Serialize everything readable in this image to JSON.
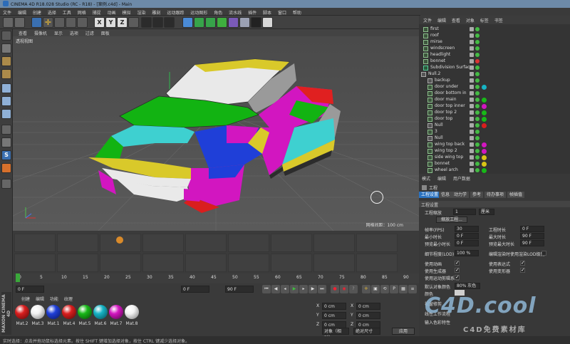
{
  "app": {
    "title": "CINEMA 4D R18.028 Studio (RC - R18) - [案例.c4d] - Main",
    "menu": [
      "文件",
      "编辑",
      "创建",
      "选择",
      "工具",
      "网格",
      "捕捉",
      "动画",
      "模拟",
      "渲染",
      "雕刻",
      "运动跟踪",
      "运动图形",
      "角色",
      "流水线",
      "插件",
      "脚本",
      "窗口",
      "帮助"
    ]
  },
  "toolbar_icons": {
    "axes": [
      "X",
      "Y",
      "Z"
    ]
  },
  "viewport": {
    "menu": [
      "查看",
      "摄像机",
      "显示",
      "选项",
      "过滤",
      "面板"
    ],
    "camera_label": "透视视图",
    "scale_label": "网格间距：100 cm"
  },
  "timeline": {
    "ticks": [
      "0",
      "5",
      "10",
      "15",
      "20",
      "25",
      "30",
      "35",
      "40",
      "45",
      "50",
      "55",
      "60",
      "65",
      "70",
      "75",
      "80",
      "85",
      "90"
    ],
    "end_frame": "90 F",
    "current_frame": "0 F",
    "field_start": "0 F",
    "field_end": "90 F",
    "min_field": "0 F"
  },
  "materials": {
    "tabs": [
      "创建",
      "编辑",
      "功能",
      "纹理"
    ],
    "items": [
      {
        "name": "Mat.2",
        "color": "#d91e1e"
      },
      {
        "name": "Mat.3",
        "color": "#f2f2f2"
      },
      {
        "name": "Mat.1",
        "color": "#1f3fd8"
      },
      {
        "name": "Mat.4",
        "color": "#d91e1e"
      },
      {
        "name": "Mat.5",
        "color": "#18b818"
      },
      {
        "name": "Mat.6",
        "color": "#16b3c4"
      },
      {
        "name": "Mat.7",
        "color": "#d216c0"
      },
      {
        "name": "Mat.8",
        "color": "#f2f2f2"
      }
    ]
  },
  "coords": {
    "labels": [
      "X",
      "Y",
      "Z",
      "X",
      "Y",
      "Z",
      "H",
      "P",
      "B"
    ],
    "value": "0 cm",
    "dropdown": "对象（相对）",
    "dropdown2": "绝对尺寸",
    "apply": "应用"
  },
  "objects": {
    "menu": [
      "文件",
      "编辑",
      "查看",
      "对象",
      "标签",
      "书签"
    ],
    "rows": [
      {
        "name": "first",
        "indent": 0
      },
      {
        "name": "roof",
        "indent": 0
      },
      {
        "name": "mirse",
        "indent": 0
      },
      {
        "name": "windscreen",
        "indent": 0
      },
      {
        "name": "headlight",
        "indent": 0
      },
      {
        "name": "bonnet",
        "indent": 0
      },
      {
        "name": "Subdivision Surface",
        "indent": 0
      },
      {
        "name": "Null.2",
        "indent": 0
      },
      {
        "name": "backup",
        "indent": 1
      },
      {
        "name": "door under",
        "indent": 1
      },
      {
        "name": "door bottom in",
        "indent": 1
      },
      {
        "name": "door main",
        "indent": 1
      },
      {
        "name": "door top inner",
        "indent": 1
      },
      {
        "name": "door top 2",
        "indent": 1
      },
      {
        "name": "door top",
        "indent": 1
      },
      {
        "name": "Null",
        "indent": 1
      },
      {
        "name": "3",
        "indent": 1
      },
      {
        "name": "Null",
        "indent": 1
      },
      {
        "name": "wing top back",
        "indent": 1
      },
      {
        "name": "wing top 2",
        "indent": 1
      },
      {
        "name": "side wing top",
        "indent": 1
      },
      {
        "name": "bonnet",
        "indent": 1
      },
      {
        "name": "wheel arch",
        "indent": 1
      }
    ],
    "mat_colors": [
      "",
      "",
      "",
      "",
      "",
      "",
      "",
      "",
      "",
      "#16b3c4",
      "",
      "#18b818",
      "#d216c0",
      "#18b818",
      "#18b818",
      "#d91e1e",
      "",
      "",
      "#d216c0",
      "#d216c0",
      "#d9c516",
      "#d9c516",
      "#18b818"
    ]
  },
  "attributes": {
    "tabs": [
      "模式",
      "编辑",
      "用户数据"
    ],
    "header": "工程",
    "subtabs": [
      "工程设置",
      "信息",
      "动力学",
      "参考",
      "待办事项",
      "帧插值"
    ],
    "section": "工程设置",
    "scale_label": "工程缩放",
    "scale_value": "1",
    "scale_unit": "厘米",
    "scale_button": "缩放工程...",
    "params_left": [
      {
        "label": "帧率(FPS)",
        "value": "30"
      },
      {
        "label": "最小时长",
        "value": "0 F"
      },
      {
        "label": "预览最小时长",
        "value": "0 F"
      },
      {
        "label": "细节程度(LOD)",
        "value": "100 %"
      }
    ],
    "params_right": [
      {
        "label": "工程时长",
        "value": "0 F"
      },
      {
        "label": "最大时长",
        "value": "90 F"
      },
      {
        "label": "预览最大时长",
        "value": "90 F"
      }
    ],
    "lod_note": "编辑渲染时使用渲染LOD级别",
    "checks_left": [
      "使用动画",
      "使用生成器",
      "使用运动剪辑系统"
    ],
    "checks_right": [
      "使用表达式",
      "使用变形器"
    ],
    "default_color_label": "默认对象颜色",
    "default_color_value": "80% 灰色",
    "color_label": "颜色",
    "view_clip_label": "视窗修剪",
    "linear_label": "线性工作流程",
    "input_color_label": "输入色彩特性"
  },
  "status_bar": "实时选择：点击并拖动鼠标选择元素。按住 SHIFT 键增加选择对象，按住 CTRL 键减少选择对象。",
  "maxon_logo": "MAXON CINEMA 4D",
  "watermark": {
    "main": "C4D.cool",
    "sub": "C4D免费素材库"
  }
}
